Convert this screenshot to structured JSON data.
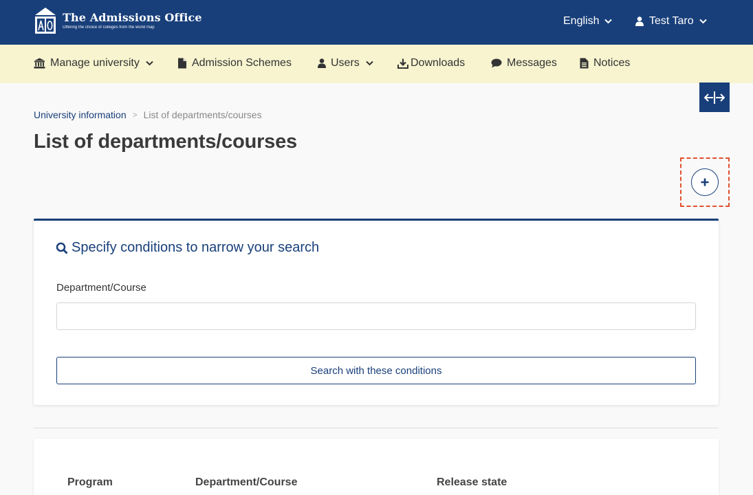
{
  "header": {
    "logo_title": "The Admissions Office",
    "logo_tagline": "Offering the choice of colleges from the world map",
    "language": "English",
    "user_name": "Test Taro"
  },
  "subnav": {
    "items": [
      {
        "label": "Manage university",
        "icon": "university-icon",
        "dropdown": true
      },
      {
        "label": "Admission Schemes",
        "icon": "document-icon",
        "dropdown": false
      },
      {
        "label": "Users",
        "icon": "user-icon",
        "dropdown": true
      },
      {
        "label": "Downloads",
        "icon": "download-icon",
        "dropdown": false
      },
      {
        "label": "Messages",
        "icon": "chat-bubble-icon",
        "dropdown": false
      },
      {
        "label": "Notices",
        "icon": "notice-icon",
        "dropdown": false
      }
    ]
  },
  "breadcrumb": {
    "parent": "University information",
    "separator": ">",
    "current": "List of departments/courses"
  },
  "page": {
    "title": "List of departments/courses"
  },
  "search": {
    "title": "Specify conditions to narrow your search",
    "field_label": "Department/Course",
    "field_value": "",
    "field_placeholder": "",
    "button_label": "Search with these conditions"
  },
  "results": {
    "columns": [
      "Program",
      "Department/Course",
      "Release state"
    ]
  },
  "colors": {
    "primary": "#183f7a",
    "subnav_bg": "#f7f4cf",
    "highlight": "#e0502f"
  }
}
